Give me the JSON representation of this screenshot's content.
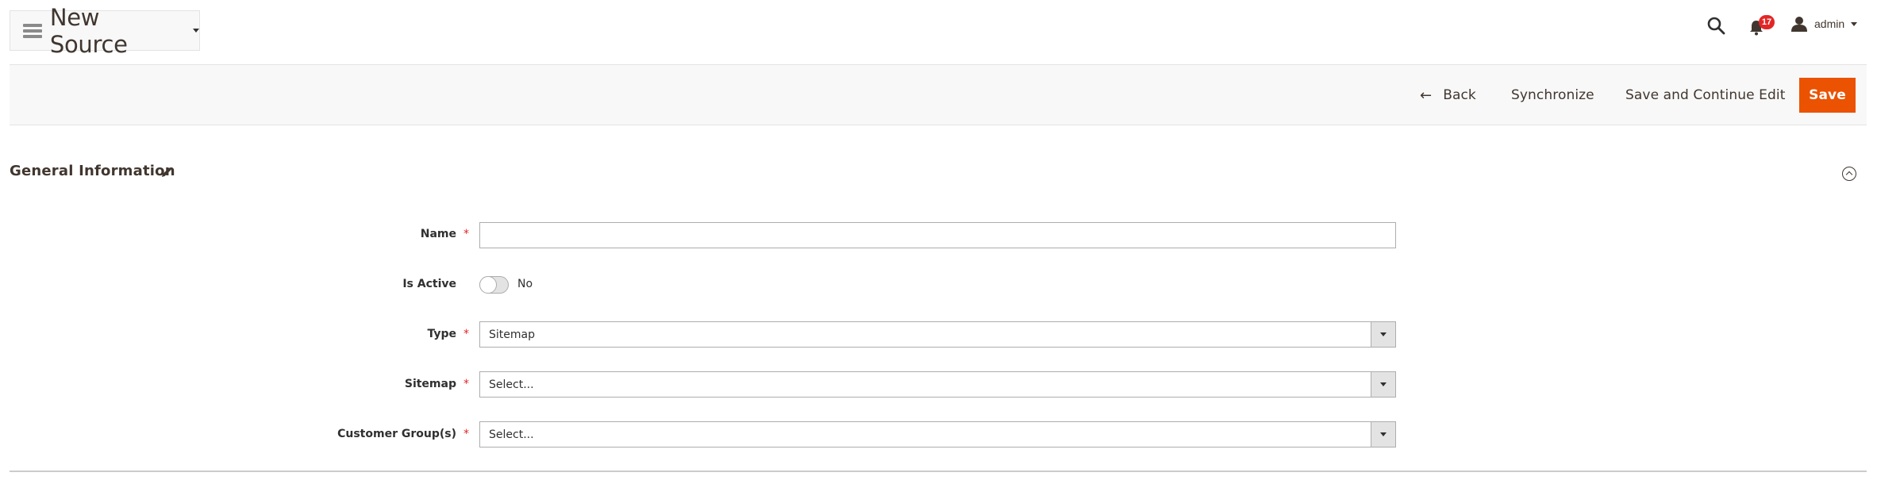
{
  "header": {
    "page_title": "New Source",
    "notifications_count": "17",
    "user_name": "admin",
    "icons": {
      "menu": "hamburger-icon",
      "search": "search-icon",
      "notifications": "bell-icon",
      "user": "user-icon"
    }
  },
  "action_bar": {
    "back_label": "Back",
    "back_icon": "←",
    "synchronize_label": "Synchronize",
    "save_continue_label": "Save and Continue Edit",
    "save_label": "Save",
    "save_color": "#eb5202"
  },
  "fieldset": {
    "title": "General Information",
    "fields": [
      {
        "label": "Name",
        "required": "*",
        "type": "text",
        "value": ""
      },
      {
        "label": "Is Active",
        "type": "toggle",
        "value": "No"
      },
      {
        "label": "Type",
        "required": "*",
        "type": "select",
        "value": "Sitemap"
      },
      {
        "label": "Sitemap",
        "required": "*",
        "type": "select",
        "value": "Select..."
      },
      {
        "label": "Customer Group(s)",
        "required": "*",
        "type": "select",
        "value": "Select..."
      }
    ]
  }
}
